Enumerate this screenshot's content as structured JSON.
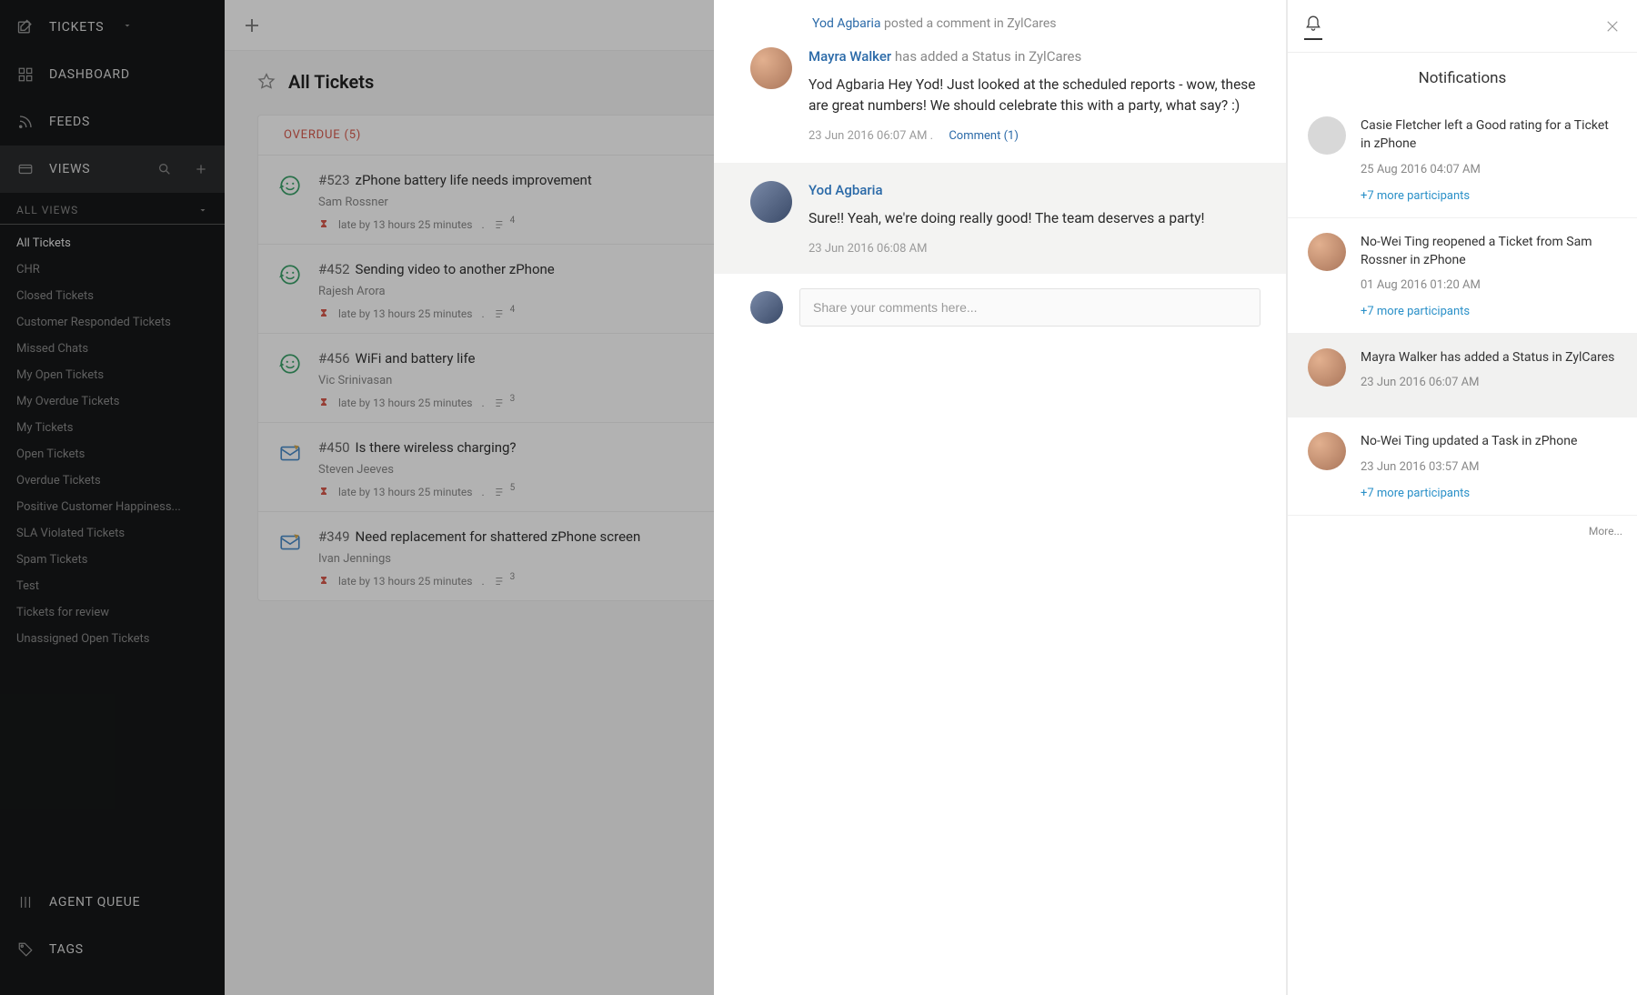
{
  "nav": {
    "tickets_label": "TICKETS",
    "dashboard_label": "DASHBOARD",
    "feeds_label": "FEEDS",
    "views_label": "VIEWS",
    "agent_queue_label": "AGENT QUEUE",
    "tags_label": "TAGS",
    "views_header": "ALL VIEWS",
    "views_items": [
      "All Tickets",
      "CHR",
      "Closed Tickets",
      "Customer Responded Tickets",
      "Missed Chats",
      "My Open Tickets",
      "My Overdue Tickets",
      "My Tickets",
      "Open Tickets",
      "Overdue Tickets",
      "Positive Customer Happiness...",
      "SLA Violated Tickets",
      "Spam Tickets",
      "Test",
      "Tickets for review",
      "Unassigned Open Tickets"
    ],
    "active_view_index": 0
  },
  "tickets": {
    "page_title": "All Tickets",
    "overdue_header": "OVERDUE (5)",
    "late_text": "late by 13 hours 25 minutes",
    "items": [
      {
        "number": "#523",
        "title": "zPhone battery life needs improvement",
        "requester": "Sam Rossner",
        "reply_count": "4",
        "type": "feedback"
      },
      {
        "number": "#452",
        "title": "Sending video to another zPhone",
        "requester": "Rajesh Arora",
        "reply_count": "4",
        "type": "feedback"
      },
      {
        "number": "#456",
        "title": "WiFi and battery life",
        "requester": "Vic Srinivasan",
        "reply_count": "3",
        "type": "feedback"
      },
      {
        "number": "#450",
        "title": "Is there wireless charging?",
        "requester": "Steven Jeeves",
        "reply_count": "5",
        "type": "mail"
      },
      {
        "number": "#349",
        "title": "Need replacement for shattered zPhone screen",
        "requester": "Ivan Jennings",
        "reply_count": "3",
        "type": "mail"
      }
    ]
  },
  "conversation": {
    "crumb_user": "Yod Agbaria",
    "crumb_rest": "posted a comment in ZylCares",
    "main_post": {
      "author": "Mayra Walker",
      "headline_rest": "has added a Status in ZylCares",
      "msg_prefix": "Yod Agbaria",
      "msg": "Hey Yod! Just looked at the scheduled reports - wow, these are great numbers! We should celebrate this with a party, what say? :)",
      "timestamp": "23 Jun 2016 06:07 AM .",
      "comment_link": "Comment (1)"
    },
    "reply_post": {
      "author": "Yod Agbaria",
      "msg": "Sure!! Yeah, we're doing really good! The team deserves a party!",
      "timestamp": "23 Jun 2016 06:08 AM"
    },
    "input_placeholder": "Share your comments here..."
  },
  "notifications": {
    "title": "Notifications",
    "more_label": "More...",
    "items": [
      {
        "text": "Casie Fletcher left a Good rating for a Ticket in zPhone",
        "timestamp": "25 Aug 2016 04:07 AM",
        "more": "+7 more participants",
        "avatar": "gray"
      },
      {
        "text": "No-Wei Ting reopened a Ticket from Sam Rossner in zPhone",
        "timestamp": "01 Aug 2016 01:20 AM",
        "more": "+7 more participants",
        "avatar": "a1"
      },
      {
        "text": "Mayra Walker has added a Status in ZylCares",
        "timestamp": "23 Jun 2016 06:07 AM",
        "more": "",
        "avatar": "a1",
        "selected": true
      },
      {
        "text": "No-Wei Ting updated a Task in zPhone",
        "timestamp": "23 Jun 2016 03:57 AM",
        "more": "+7 more participants",
        "avatar": "a1"
      }
    ]
  }
}
